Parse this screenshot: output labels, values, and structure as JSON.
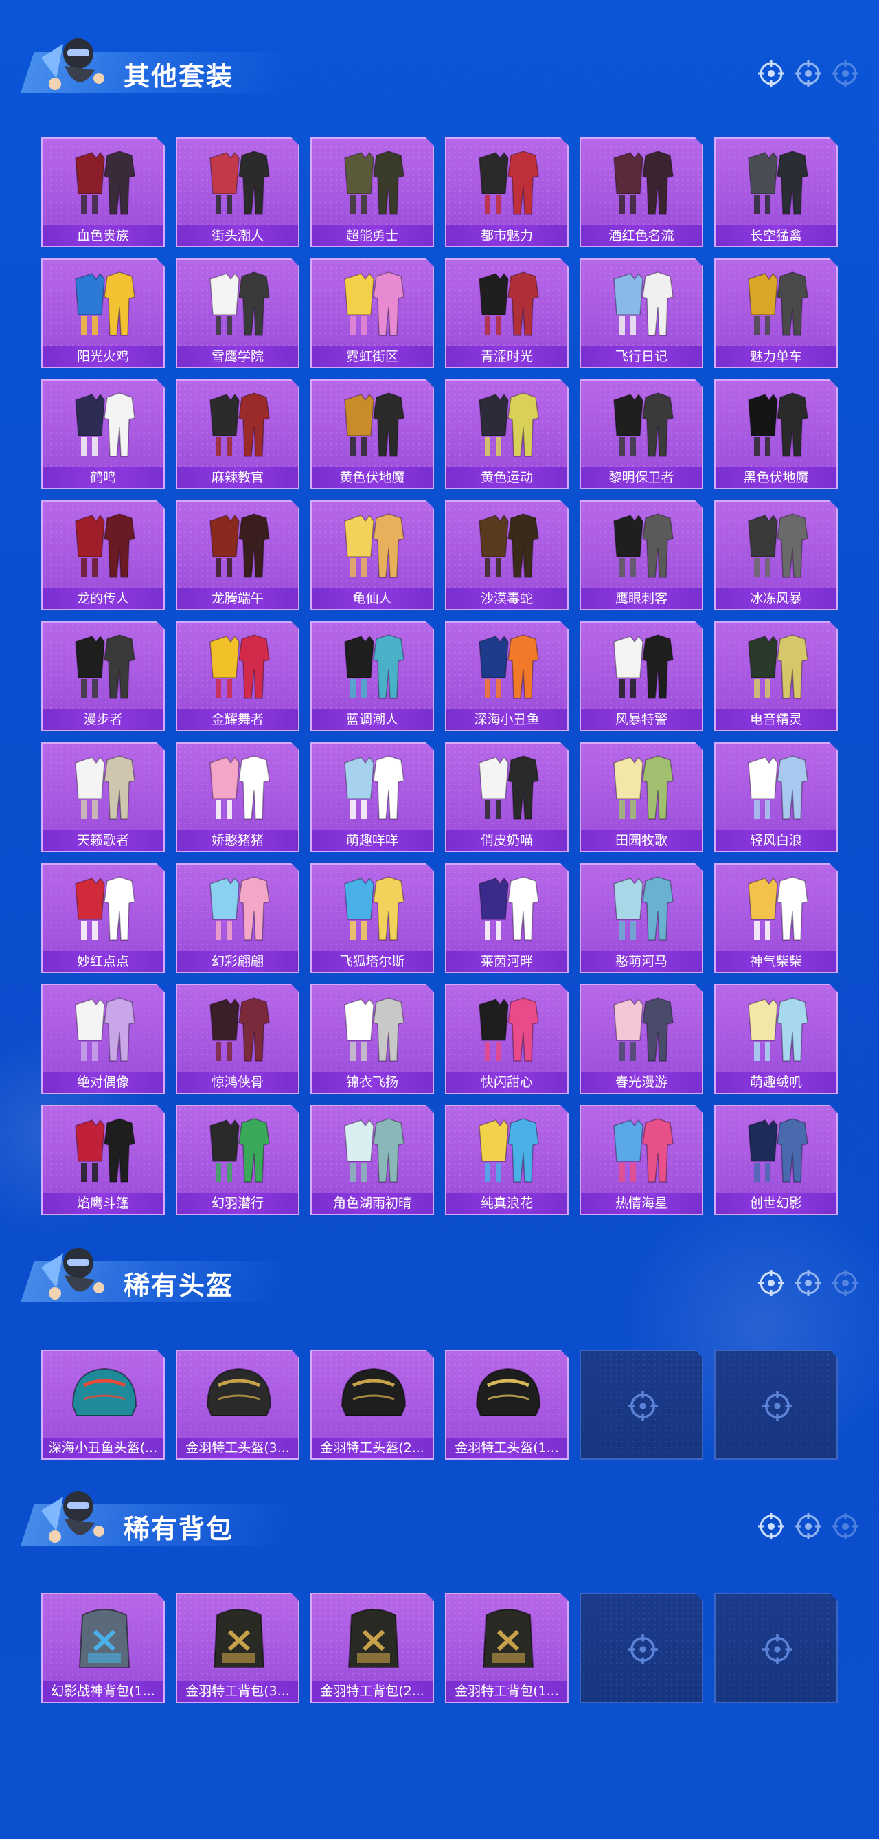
{
  "colors": {
    "background": "#0b55d6",
    "card_purple": "#b667e8",
    "card_label": "#8e3ae0",
    "empty_card": "#1a3a8a",
    "title_text": "#ffffff"
  },
  "sections": {
    "outfits": {
      "title": "其他套装",
      "items": [
        "血色贵族",
        "街头潮人",
        "超能勇士",
        "都市魅力",
        "酒红色名流",
        "长空猛禽",
        "阳光火鸡",
        "雪鹰学院",
        "霓虹街区",
        "青涩时光",
        "飞行日记",
        "魅力单车",
        "鹤鸣",
        "麻辣教官",
        "黄色伏地魔",
        "黄色运动",
        "黎明保卫者",
        "黑色伏地魔",
        "龙的传人",
        "龙腾端午",
        "龟仙人",
        "沙漠毒蛇",
        "鹰眼刺客",
        "冰冻风暴",
        "漫步者",
        "金耀舞者",
        "蓝调潮人",
        "深海小丑鱼",
        "风暴特警",
        "电音精灵",
        "天籁歌者",
        "娇憨猪猪",
        "萌趣咩咩",
        "俏皮奶喵",
        "田园牧歌",
        "轻风白浪",
        "妙红点点",
        "幻彩翩翩",
        "飞狐塔尔斯",
        "莱茵河畔",
        "憨萌河马",
        "神气柴柴",
        "绝对偶像",
        "惊鸿侠骨",
        "锦衣飞扬",
        "快闪甜心",
        "春光漫游",
        "萌趣绒叽",
        "焰鹰斗篷",
        "幻羽潜行",
        "角色湖雨初晴",
        "纯真浪花",
        "热情海星",
        "创世幻影"
      ]
    },
    "helmets": {
      "title": "稀有头盔",
      "items": [
        "深海小丑鱼头盔(...",
        "金羽特工头盔(3...",
        "金羽特工头盔(2...",
        "金羽特工头盔(1..."
      ],
      "empty_slots": 2
    },
    "backpacks": {
      "title": "稀有背包",
      "items": [
        "幻影战神背包(1...",
        "金羽特工背包(3...",
        "金羽特工背包(2...",
        "金羽特工背包(1..."
      ],
      "empty_slots": 2
    }
  },
  "icons": {
    "section_mascot": "soldier-mascot-icon",
    "header_decoration": "crosshair-target-icon",
    "empty_slot": "crosshair-target-icon"
  }
}
